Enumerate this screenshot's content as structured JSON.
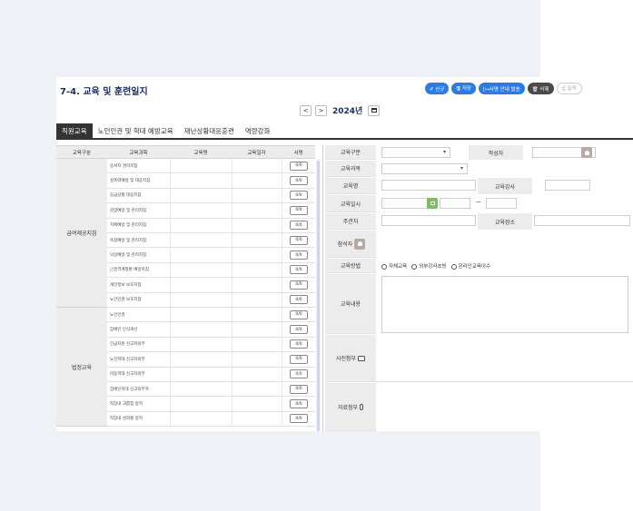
{
  "page": {
    "title": "7-4. 교육 및 훈련일지",
    "toolbar": {
      "new": "✐ 신규",
      "save": "🖫 저장",
      "notice": "[↦서명 안내 발송",
      "delete": "🗑 삭제",
      "print": "⎙ 출력"
    },
    "year_nav": {
      "prev": "<",
      "next": ">",
      "year": "2024년"
    }
  },
  "tabs": [
    "직원교육",
    "노인인권 및 학대 예방교육",
    "재난상황대응훈련",
    "역량강화"
  ],
  "grid": {
    "headers": [
      "교육구분",
      "교육과목",
      "교육명",
      "교육일자",
      "서명"
    ],
    "groups": [
      {
        "name": "급여제공지침",
        "items": [
          "응서자 권리지침",
          "성폭력예방 및 대응지침",
          "응급상황 대응지침",
          "감염예방 및 관리지침",
          "치매예방 및 관리지침",
          "욕창예방 및 관리지침",
          "낙상예방 및 관리지침",
          "근골격계질환 예방지침",
          "개인정보 보호지침",
          "노인인권 보호지침"
        ]
      },
      {
        "name": "법정교육",
        "items": [
          "노인인권",
          "장애인 인식개선",
          "긴급지원 신고자의무",
          "노인학대 신고자의무",
          "아동학대 신고자의무",
          "장애인학대 신고의무자",
          "직장내 괴롭힘 방지",
          "직장내 성희롱 방지"
        ]
      }
    ],
    "sign_value": "0/0"
  },
  "form": {
    "category_label": "교육구분",
    "author_label": "작성자",
    "subject_label": "교육과목",
    "name_label": "교육명",
    "instructor_label": "교육강사",
    "datetime_label": "교육일시",
    "tilde": "~",
    "host_label": "주관처",
    "place_label": "교육장소",
    "attendees_label": "참석자",
    "method_label": "교육방법",
    "methods": [
      "자체교육",
      "외부강사초빙",
      "온라인교육이수"
    ],
    "content_label": "교육내용",
    "photo_label": "사진첨부",
    "file_label": "자료첨부"
  }
}
